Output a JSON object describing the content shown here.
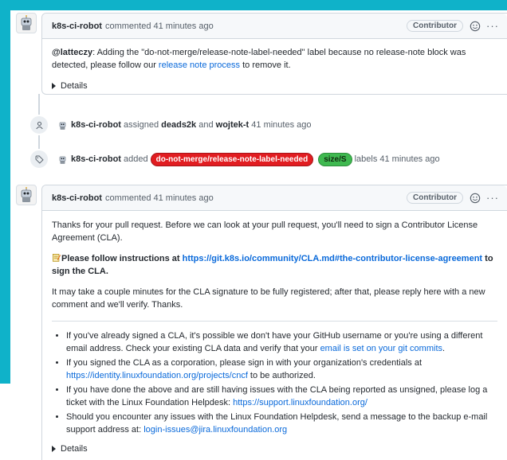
{
  "comment1": {
    "author": "k8s-ci-robot",
    "action_time": "commented 41 minutes ago",
    "badge": "Contributor",
    "mention": "@latteczy",
    "text_before_link": ": Adding the \"do-not-merge/release-note-label-needed\" label because no release-note block was detected, please follow our ",
    "link": "release note process",
    "text_after_link": " to remove it.",
    "details": "Details"
  },
  "event_assigned": {
    "actor": "k8s-ci-robot",
    "verb": "assigned",
    "assignee1": "deads2k",
    "and": "and",
    "assignee2": "wojtek-t",
    "time": "41 minutes ago"
  },
  "event_labeled": {
    "actor": "k8s-ci-robot",
    "verb": "added",
    "label1": "do-not-merge/release-note-label-needed",
    "label2": "size/S",
    "suffix": "labels 41 minutes ago",
    "label1_color": "#e11d21",
    "label2_color": "#3fb950"
  },
  "comment2": {
    "author": "k8s-ci-robot",
    "action_time": "commented 41 minutes ago",
    "badge": "Contributor",
    "para1": "Thanks for your pull request. Before we can look at your pull request, you'll need to sign a Contributor License Agreement (CLA).",
    "para2_prefix": "Please follow instructions at ",
    "para2_link": "https://git.k8s.io/community/CLA.md#the-contributor-license-agreement",
    "para2_suffix": " to sign the CLA.",
    "para3": "It may take a couple minutes for the CLA signature to be fully registered; after that, please reply here with a new comment and we'll verify. Thanks.",
    "bullets": {
      "b1_text": "If you've already signed a CLA, it's possible we don't have your GitHub username or you're using a different email address. Check your existing CLA data and verify that your ",
      "b1_link": "email is set on your git commits",
      "b1_end": ".",
      "b2_text": "If you signed the CLA as a corporation, please sign in with your organization's credentials at ",
      "b2_link": "https://identity.linuxfoundation.org/projects/cncf",
      "b2_end": " to be authorized.",
      "b3_text": "If you have done the above and are still having issues with the CLA being reported as unsigned, please log a ticket with the Linux Foundation Helpdesk: ",
      "b3_link": "https://support.linuxfoundation.org/",
      "b4_text": "Should you encounter any issues with the Linux Foundation Helpdesk, send a message to the backup e-mail support address at: ",
      "b4_link": "login-issues@jira.linuxfoundation.org"
    },
    "details": "Details"
  },
  "icons": {
    "avatar": "robot-avatar-icon",
    "smiley": "smiley-icon",
    "kebab": "kebab-horizontal-icon",
    "person": "person-icon",
    "tag": "tag-icon"
  },
  "colors": {
    "accent_frame": "#0fb2c9",
    "link": "#0969da"
  }
}
